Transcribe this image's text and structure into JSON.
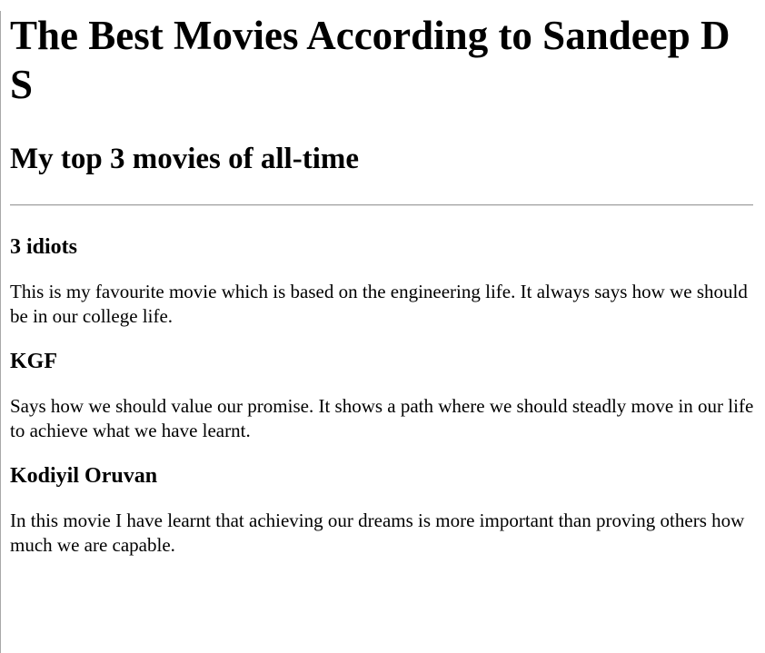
{
  "page": {
    "title": "The Best Movies According to Sandeep D S",
    "subtitle": "My top 3 movies of all-time"
  },
  "movies": [
    {
      "title": "3 idiots",
      "description": "This is my favourite movie which is based on the engineering life. It always says how we should be in our college life."
    },
    {
      "title": "KGF",
      "description": "Says how we should value our promise. It shows a path where we should steadly move in our life to achieve what we have learnt."
    },
    {
      "title": "Kodiyil Oruvan",
      "description": "In this movie I have learnt that achieving our dreams is more important than proving others how much we are capable."
    }
  ]
}
